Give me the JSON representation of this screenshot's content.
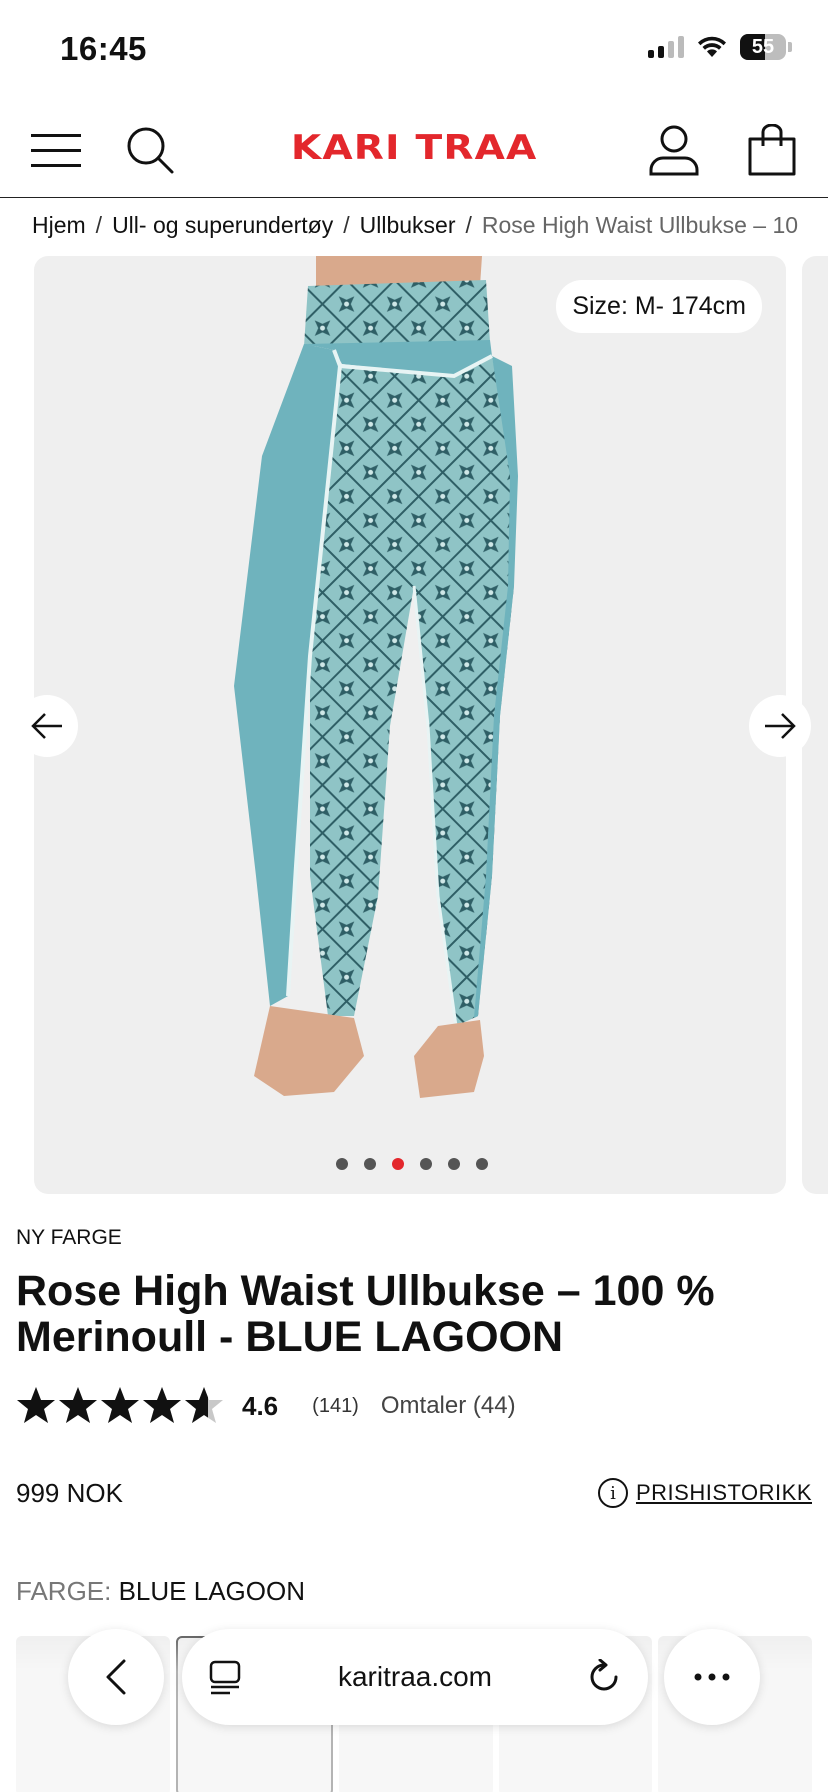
{
  "status_bar": {
    "time": "16:45",
    "battery": "55"
  },
  "header": {
    "logo_text": "KARI TRAA",
    "brand_color": "#e3272c",
    "icons": [
      "menu-icon",
      "search-icon",
      "account-icon",
      "shopping-bag-icon"
    ]
  },
  "breadcrumb": {
    "items": [
      "Hjem",
      "Ull- og superundertøy",
      "Ullbukser"
    ],
    "current": "Rose High Waist Ullbukse – 10"
  },
  "gallery": {
    "size_badge": "Size: M- 174cm",
    "slide_count": 6,
    "active_slide": 3,
    "colors": {
      "background": "#efefef",
      "active_dot": "#e3272c",
      "inactive_dot": "#555555"
    }
  },
  "product": {
    "badge": "NY FARGE",
    "title": "Rose High Waist Ullbukse – 100 % Merinoull - BLUE LAGOON",
    "rating": "4.6",
    "rating_stars": 4.6,
    "rating_count": "(141)",
    "reviews_link": "Omtaler (44)",
    "price": "999 NOK",
    "price_history_label": "PRISHISTORIKK",
    "color_label": "FARGE:",
    "color_value": "BLUE LAGOON"
  },
  "browser": {
    "url": "karitraa.com",
    "icons": [
      "back-icon",
      "tabs-icon",
      "reload-icon",
      "more-icon"
    ]
  }
}
